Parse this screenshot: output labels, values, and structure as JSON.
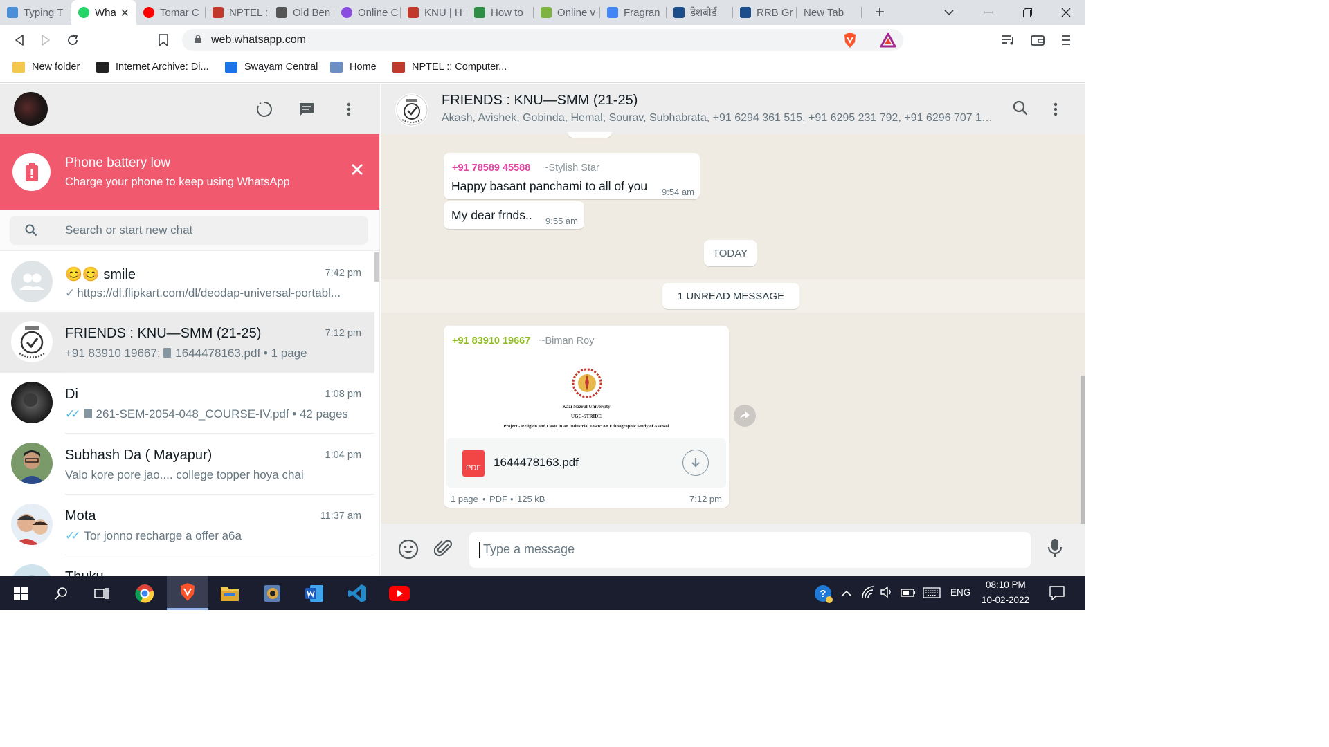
{
  "browser": {
    "tabs": [
      {
        "label": "Typing T",
        "icon": "t-letter-icon",
        "color": "#4a90d9"
      },
      {
        "label": "Wha",
        "icon": "whatsapp-icon",
        "color": "#25d366",
        "active": true
      },
      {
        "label": "Tomar C",
        "icon": "youtube-icon",
        "color": "#ff0000"
      },
      {
        "label": "NPTEL ::",
        "icon": "nptel-icon",
        "color": "#c0392b"
      },
      {
        "label": "Old Ben",
        "icon": "globe-icon",
        "color": "#555555"
      },
      {
        "label": "Online C",
        "icon": "online-icon",
        "color": "#8a4de0"
      },
      {
        "label": "KNU | H",
        "icon": "knu-icon",
        "color": "#c0392b"
      },
      {
        "label": "How to",
        "icon": "geeks-icon",
        "color": "#2f8d46"
      },
      {
        "label": "Online v",
        "icon": "download-icon",
        "color": "#7cb342"
      },
      {
        "label": "Fragran",
        "icon": "google-icon",
        "color": "#4285f4"
      },
      {
        "label": "डेशबोर्ड",
        "icon": "bookmark-logo-icon",
        "color": "#1a4f8b"
      },
      {
        "label": "RRB Gr",
        "icon": "bookmark-logo-icon",
        "color": "#1a4f8b"
      },
      {
        "label": "New Tab",
        "icon": "",
        "color": ""
      }
    ],
    "new_tab_symbol": "+",
    "url": "web.whatsapp.com",
    "bookmarks": [
      {
        "label": "New folder",
        "icon": "folder-icon",
        "color": "#f2c94c"
      },
      {
        "label": "Internet Archive: Di...",
        "icon": "archive-icon",
        "color": "#222222"
      },
      {
        "label": "Swayam Central",
        "icon": "swayam-icon",
        "color": "#1a73e8"
      },
      {
        "label": "Home",
        "icon": "home-site-icon",
        "color": "#6b8fc2"
      },
      {
        "label": "NPTEL :: Computer...",
        "icon": "nptel-icon",
        "color": "#c0392b"
      }
    ]
  },
  "whatsapp": {
    "battery_alert": {
      "title": "Phone battery low",
      "subtitle": "Charge your phone to keep using WhatsApp",
      "color": "#f1596f"
    },
    "search_placeholder": "Search or start new chat",
    "chats": [
      {
        "name": "😊😊 smile",
        "time": "7:42 pm",
        "preview": "https://dl.flipkart.com/dl/deodap-universal-portabl...",
        "tick": "single",
        "doc": false,
        "avatar": "group-placeholder"
      },
      {
        "name": "FRIENDS : KNU—SMM (21-25)",
        "time": "7:12 pm",
        "preview": "+91 83910 19667: 1644478163.pdf • 1 page",
        "tick": "",
        "doc": true,
        "selected": true,
        "avatar": "knu-logo"
      },
      {
        "name": "Di",
        "time": "1:08 pm",
        "preview": "261-SEM-2054-048_COURSE-IV.pdf • 42 pages",
        "tick": "double-blue",
        "doc": true,
        "avatar": "photo-dark"
      },
      {
        "name": "Subhash Da ( Mayapur)",
        "time": "1:04 pm",
        "preview": "Valo kore pore jao.... college topper hoya chai",
        "tick": "",
        "doc": false,
        "avatar": "photo-man"
      },
      {
        "name": "Mota",
        "time": "11:37 am",
        "preview": "Tor jonno recharge a offer a6a",
        "tick": "double-blue",
        "doc": false,
        "avatar": "photo-kids"
      },
      {
        "name": "Thuku",
        "time": "",
        "preview": "",
        "tick": "",
        "doc": false,
        "avatar": "photo-light"
      }
    ],
    "conversation": {
      "title": "FRIENDS : KNU—SMM (21-25)",
      "members": "Akash, Avishek, Gobinda, Hemal, Sourav, Subhabrata, +91 6294 361 515, +91 6295 231 792, +91 6296 707 175,...",
      "messages": [
        {
          "sender": "+91 78589 45588",
          "alias": "~Stylish Star",
          "text": "Happy basant panchami to all of you",
          "time": "9:54 am",
          "sender_color": "#e542a3"
        },
        {
          "text": "My dear frnds..",
          "time": "9:55 am"
        }
      ],
      "date_pill": "TODAY",
      "unread_pill": "1 UNREAD MESSAGE",
      "doc_message": {
        "sender": "+91 83910 19667",
        "alias": "~Biman Roy",
        "sender_color": "#8fbc25",
        "preview_lines": [
          "Kazi Nazrul University",
          "UGC-STRIDE",
          "Project - Religion and Caste in an Industrial Town: An Ethnographic Study of Asansol"
        ],
        "pdf_badge": "PDF",
        "filename": "1644478163.pdf",
        "meta": [
          "1 page",
          "PDF",
          "125 kB"
        ],
        "time": "7:12 pm"
      },
      "compose_placeholder": "Type a message"
    }
  },
  "taskbar": {
    "apps": [
      "windows-start-icon",
      "search-icon",
      "task-view-icon",
      "chrome-icon",
      "brave-icon",
      "file-explorer-icon",
      "photo-app-icon",
      "word-icon",
      "vscode-icon",
      "youtube-icon"
    ],
    "language": "ENG",
    "time": "08:10 PM",
    "date": "10-02-2022"
  }
}
